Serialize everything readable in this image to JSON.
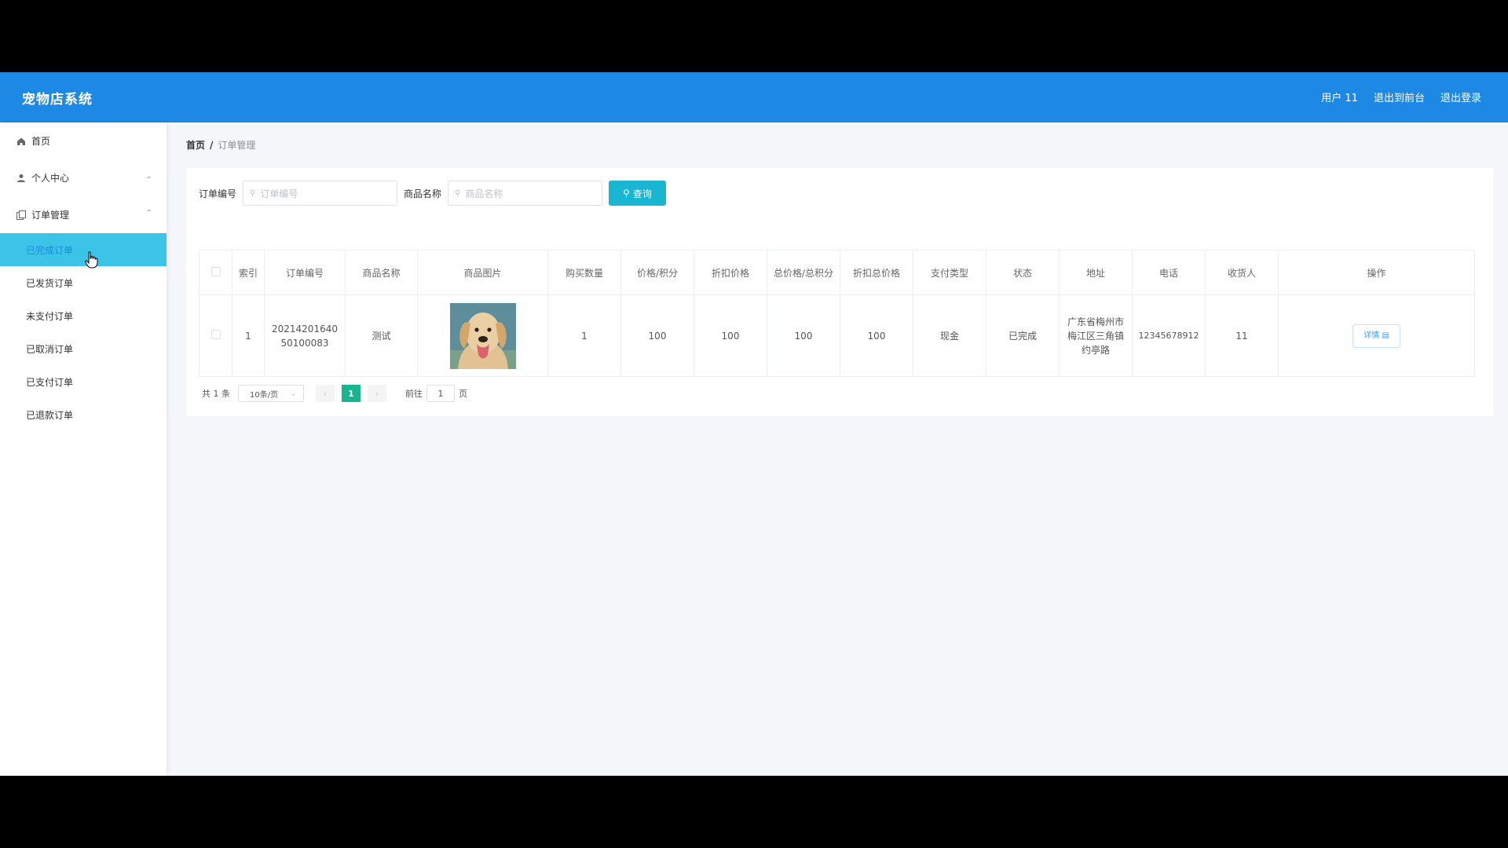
{
  "app": {
    "brand": "宠物店系统"
  },
  "header": {
    "user": "用户 11",
    "front": "退出到前台",
    "logout": "退出登录"
  },
  "sidebar": {
    "home": "首页",
    "personal": "个人中心",
    "orders": "订单管理",
    "sub": [
      "已完成订单",
      "已发货订单",
      "未支付订单",
      "已取消订单",
      "已支付订单",
      "已退款订单"
    ]
  },
  "breadcrumb": {
    "home": "首页",
    "sep": "/",
    "current": "订单管理"
  },
  "search": {
    "order_label": "订单编号",
    "order_placeholder": "订单编号",
    "goods_label": "商品名称",
    "goods_placeholder": "商品名称",
    "button": "查询"
  },
  "table": {
    "headers": [
      "索引",
      "订单编号",
      "商品名称",
      "商品图片",
      "购买数量",
      "价格/积分",
      "折扣价格",
      "总价格/总积分",
      "折扣总价格",
      "支付类型",
      "状态",
      "地址",
      "电话",
      "收货人",
      "操作"
    ],
    "rows": [
      {
        "index": "1",
        "order_no": "2021420164050100083",
        "goods": "测试",
        "qty": "1",
        "price": "100",
        "discount": "100",
        "total": "100",
        "discount_total": "100",
        "pay_type": "现金",
        "status": "已完成",
        "address": "广东省梅州市梅江区三角镇约亭路",
        "phone": "12345678912",
        "receiver": "11",
        "action": "详情"
      }
    ]
  },
  "pager": {
    "total": "共 1 条",
    "size": "10条/页",
    "current": "1",
    "goto_label": "前往",
    "goto_value": "1",
    "page_suffix": "页"
  },
  "colors": {
    "header": "#1e88e5",
    "active_menu": "#3bc3e8",
    "query_button": "#18b6d3",
    "page_active": "#19b58e"
  }
}
